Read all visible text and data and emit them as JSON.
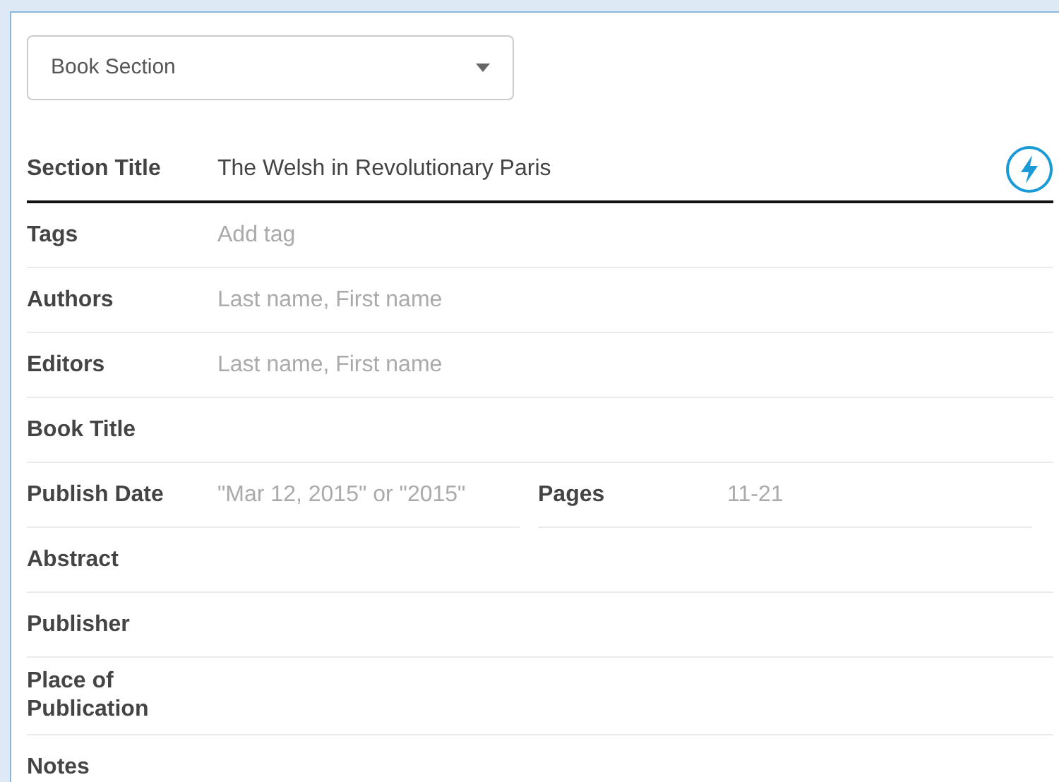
{
  "item_type": {
    "value": "Book Section"
  },
  "fields": [
    {
      "kind": "text",
      "label": "Section Title",
      "value": "The Welsh in Revolutionary Paris",
      "focused": true
    },
    {
      "kind": "text",
      "label": "Tags",
      "placeholder": "Add tag",
      "focused": false
    },
    {
      "kind": "text",
      "label": "Authors",
      "placeholder": "Last name, First name",
      "focused": false
    },
    {
      "kind": "text",
      "label": "Editors",
      "placeholder": "Last name, First name",
      "focused": false
    },
    {
      "kind": "text",
      "label": "Book Title",
      "focused": false
    },
    {
      "kind": "pair",
      "label": "Publish Date",
      "placeholder": "\"Mar 12, 2015\" or \"2015\"",
      "label_2": "Pages",
      "placeholder_2": "11-21",
      "focused": false
    },
    {
      "kind": "text",
      "label": "Abstract",
      "focused": false
    },
    {
      "kind": "text",
      "label": "Publisher",
      "focused": false
    },
    {
      "kind": "text",
      "label": "Place of Publication",
      "focused": false
    },
    {
      "kind": "text",
      "label": "Notes",
      "focused": false
    }
  ]
}
